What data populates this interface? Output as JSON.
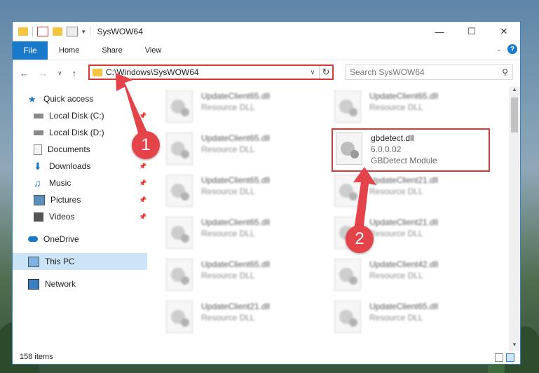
{
  "window": {
    "title": "SysWOW64"
  },
  "ribbon": {
    "tabs": [
      "File",
      "Home",
      "Share",
      "View"
    ],
    "help": "?"
  },
  "address": {
    "path": "C:\\Windows\\SysWOW64"
  },
  "search": {
    "placeholder": "Search SysWOW64"
  },
  "sidebar": {
    "items": [
      {
        "label": "Quick access",
        "icon": "star-icon"
      },
      {
        "label": "Local Disk (C:)",
        "icon": "drive-icon",
        "pinned": true
      },
      {
        "label": "Local Disk (D:)",
        "icon": "drive-icon"
      },
      {
        "label": "Documents",
        "icon": "documents-icon",
        "pinned": true
      },
      {
        "label": "Downloads",
        "icon": "downloads-icon",
        "pinned": true
      },
      {
        "label": "Music",
        "icon": "music-icon",
        "pinned": true
      },
      {
        "label": "Pictures",
        "icon": "pictures-icon",
        "pinned": true
      },
      {
        "label": "Videos",
        "icon": "videos-icon",
        "pinned": true
      },
      {
        "label": "OneDrive",
        "icon": "onedrive-icon"
      },
      {
        "label": "This PC",
        "icon": "computer-icon",
        "selected": true
      },
      {
        "label": "Network",
        "icon": "network-icon"
      }
    ]
  },
  "files": [
    {
      "name": "UpdateClient65.dll",
      "desc": "Resource DLL"
    },
    {
      "name": "UpdateClient65.dll",
      "desc": "Resource DLL"
    },
    {
      "name": "UpdateClient65.dll",
      "desc": "Resource DLL"
    },
    {
      "name": "gbdetect.dll",
      "version": "6.0.0.02",
      "desc": "GBDetect Module"
    },
    {
      "name": "UpdateClient65.dll",
      "desc": "Resource DLL"
    },
    {
      "name": "UpdateClient21.dll",
      "desc": "Resource DLL"
    },
    {
      "name": "UpdateClient65.dll",
      "desc": "Resource DLL"
    },
    {
      "name": "UpdateClient21.dll",
      "desc": "Resource DLL"
    },
    {
      "name": "UpdateClient65.dll",
      "desc": "Resource DLL"
    },
    {
      "name": "UpdateClient42.dll",
      "desc": "Resource DLL"
    },
    {
      "name": "UpdateClient21.dll",
      "desc": "Resource DLL"
    },
    {
      "name": "UpdateClient65.dll",
      "desc": "Resource DLL"
    }
  ],
  "status": {
    "count": "158 items"
  },
  "callouts": [
    "1",
    "2"
  ],
  "colors": {
    "accent": "#1979ca",
    "highlight": "#d43a3a",
    "callout": "#e5434a"
  }
}
